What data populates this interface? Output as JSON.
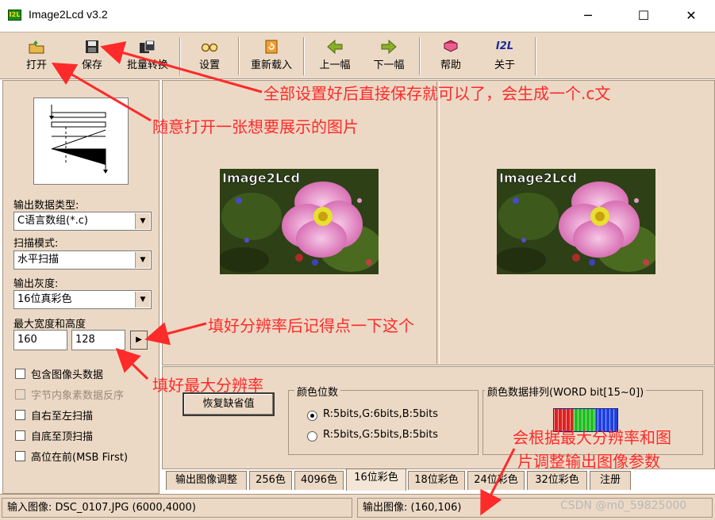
{
  "window": {
    "title": "Image2Lcd v3.2",
    "icon_text": "I2L",
    "min_glyph": "─",
    "max_glyph": "☐",
    "close_glyph": "✕"
  },
  "toolbar": {
    "open": "打开",
    "save": "保存",
    "batch": "批量转换",
    "settings": "设置",
    "reload": "重新载入",
    "prev": "上一幅",
    "next": "下一幅",
    "help": "帮助",
    "about": "关于",
    "about_icon_text": "I2L"
  },
  "left": {
    "output_type_label": "输出数据类型:",
    "output_type_value": "C语言数组(*.c)",
    "scan_mode_label": "扫描模式:",
    "scan_mode_value": "水平扫描",
    "gray_label": "输出灰度:",
    "gray_value": "16位真彩色",
    "size_label": "最大宽度和高度",
    "width_value": "160",
    "height_value": "128",
    "apply_glyph": "▶",
    "checkboxes": [
      "包含图像头数据",
      "字节内象素数据反序",
      "自右至左扫描",
      "自底至顶扫描",
      "高位在前(MSB First)"
    ]
  },
  "preview": {
    "watermark": "Image2Lcd"
  },
  "options": {
    "restore_button": "恢复缺省值",
    "color_bits_title": "颜色位数",
    "radio_565": "R:5bits,G:6bits,B:5bits",
    "radio_555": "R:5bits,G:5bits,B:5bits",
    "order_title": "颜色数据排列(WORD bit[15~0])"
  },
  "tabs": [
    "输出图像调整",
    "256色",
    "4096色",
    "16位彩色",
    "18位彩色",
    "24位彩色",
    "32位彩色",
    "注册"
  ],
  "status": {
    "input": "输入图像: DSC_0107.JPG (6000,4000)",
    "output": "输出图像: (160,106)",
    "watermark": "CSDN @m0_59825000"
  },
  "annotations": {
    "save_note": "全部设置好后直接保存就可以了，会生成一个.c文",
    "open_note": "随意打开一张想要展示的图片",
    "apply_note": "填好分辨率后记得点一下这个",
    "size_note": "填好最大分辨率",
    "output_note_1": "会根据最大分辨率和图",
    "output_note_2": "片调整输出图像参数"
  },
  "colors": {
    "panel": "#ecd9c5",
    "annotation": "#ff2a2a"
  }
}
